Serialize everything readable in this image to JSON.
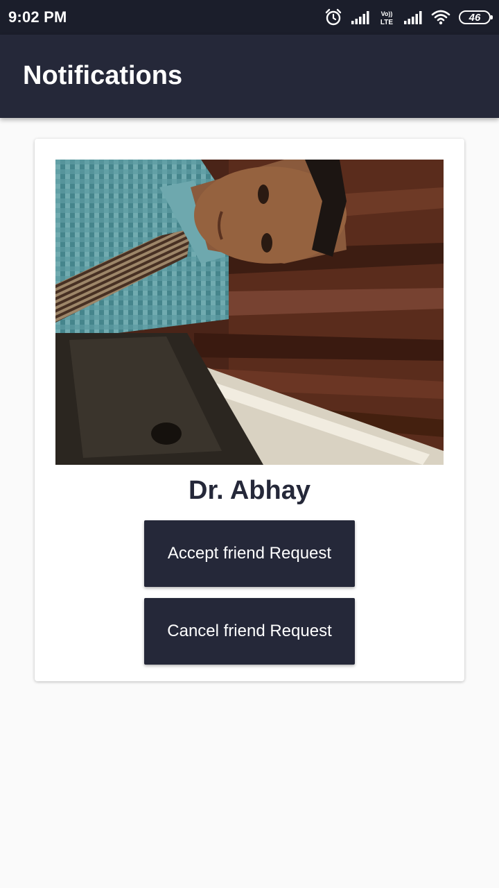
{
  "status_bar": {
    "time": "9:02 PM",
    "battery": "46",
    "icons": [
      "alarm-icon",
      "signal-icon",
      "volte-icon",
      "signal-icon",
      "wifi-icon",
      "battery-icon"
    ]
  },
  "app_bar": {
    "title": "Notifications"
  },
  "request_card": {
    "name": "Dr. Abhay",
    "accept_label": "Accept friend Request",
    "cancel_label": "Cancel friend Request"
  },
  "colors": {
    "primary": "#252839",
    "status_bar": "#1b1e2b",
    "background": "#fafafa",
    "card": "#ffffff"
  }
}
